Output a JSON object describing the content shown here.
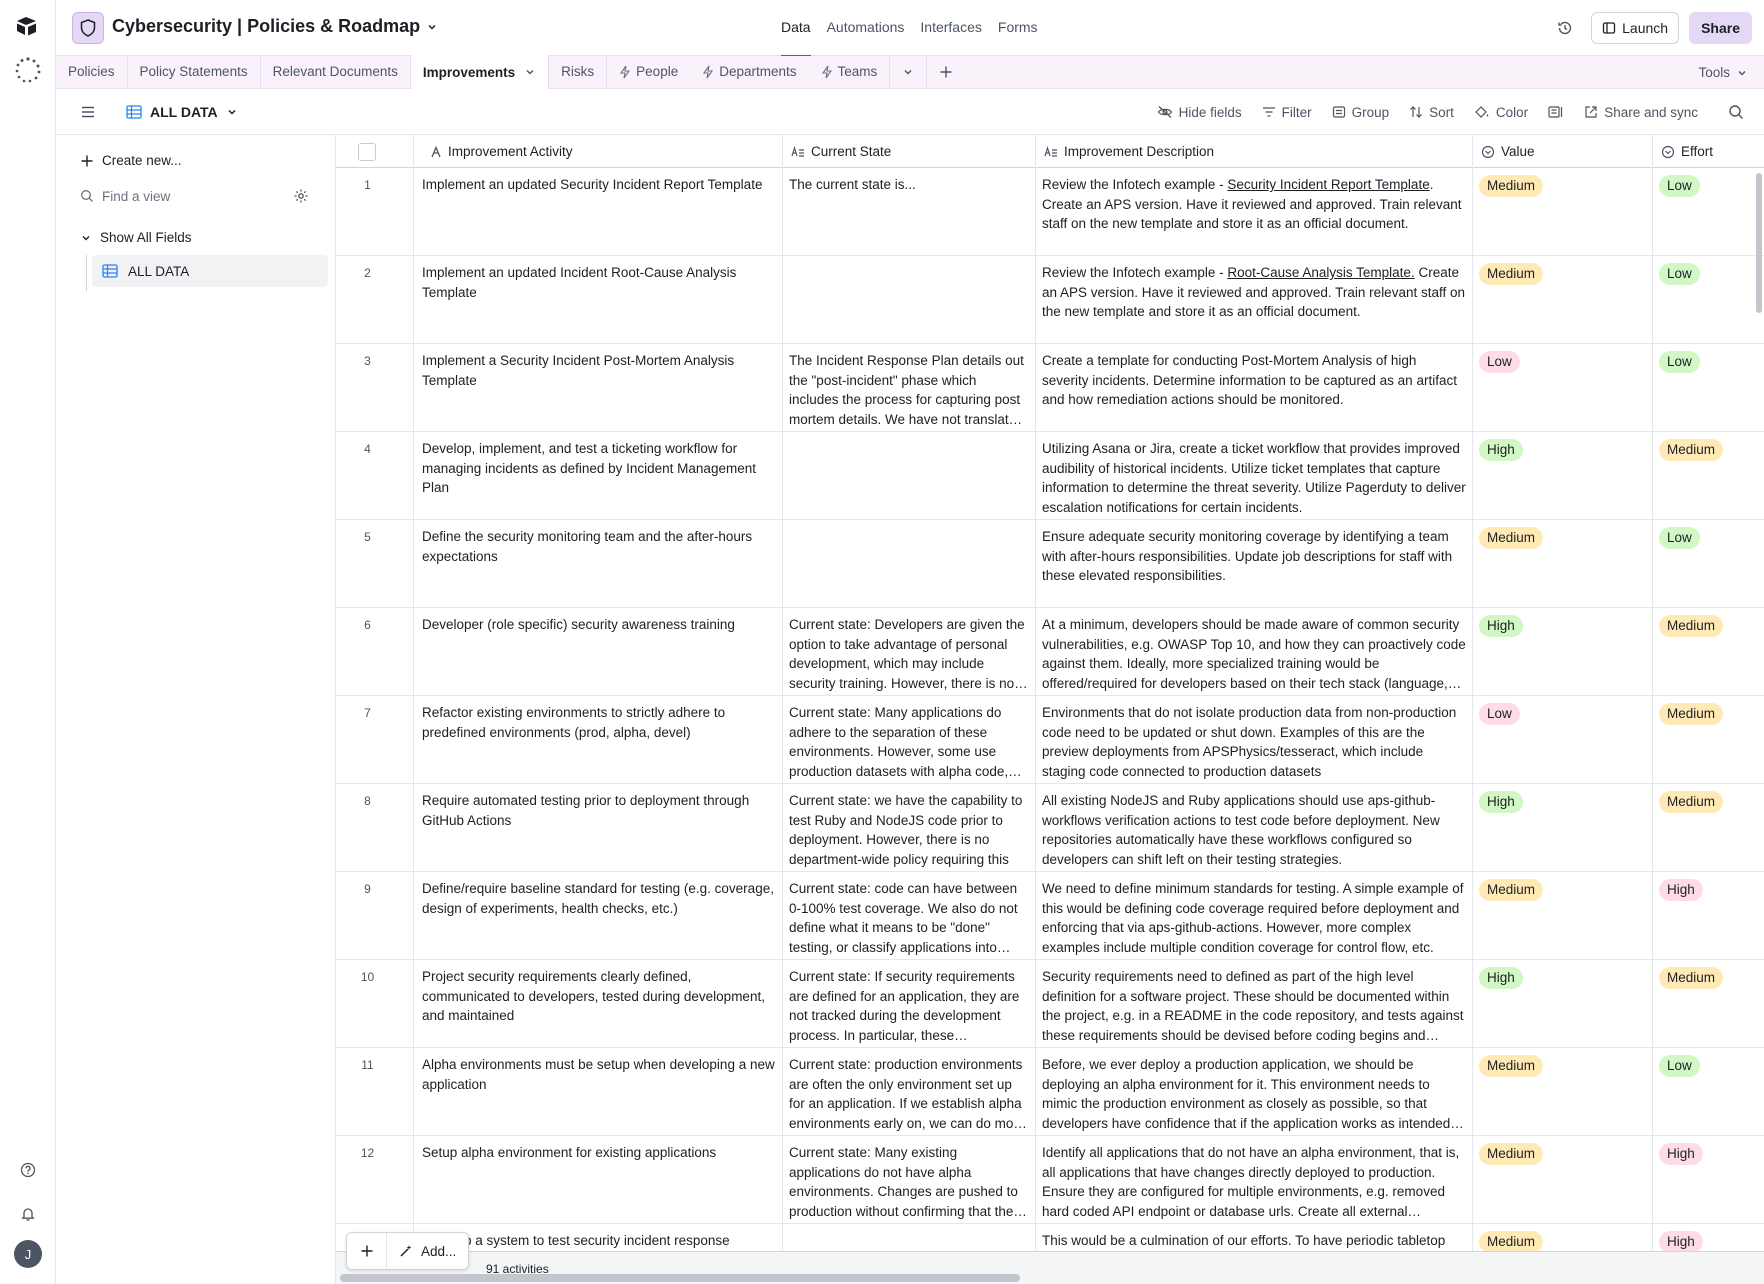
{
  "base": {
    "title": "Cybersecurity | Policies & Roadmap"
  },
  "top_nav": {
    "data": "Data",
    "automations": "Automations",
    "interfaces": "Interfaces",
    "forms": "Forms"
  },
  "top_right": {
    "launch": "Launch",
    "share": "Share"
  },
  "user": {
    "initial": "J"
  },
  "table_tabs": [
    "Policies",
    "Policy Statements",
    "Relevant Documents",
    "Improvements",
    "Risks",
    "People",
    "Departments",
    "Teams"
  ],
  "tools_label": "Tools",
  "view": {
    "name": "ALL DATA"
  },
  "viewbar": {
    "hide_fields": "Hide fields",
    "filter": "Filter",
    "group": "Group",
    "sort": "Sort",
    "color": "Color",
    "share_sync": "Share and sync"
  },
  "sidebar": {
    "create_new": "Create new...",
    "find_placeholder": "Find a view",
    "section": "Show All Fields",
    "view_item": "ALL DATA"
  },
  "columns": {
    "activity": "Improvement Activity",
    "current": "Current State",
    "description": "Improvement Description",
    "value": "Value",
    "effort": "Effort"
  },
  "rows": [
    {
      "num": "1",
      "activity": "Implement an updated Security Incident Report Template",
      "current": "The current state is...",
      "desc_pre": "Review the Infotech example - ",
      "desc_link": "Security Incident Report Template",
      "desc_post": ". Create an APS version. Have it reviewed and approved. Train relevant staff on the new template and store it as an official document.",
      "value": "Medium",
      "effort": "Low"
    },
    {
      "num": "2",
      "activity": "Implement an updated Incident Root-Cause Analysis Template",
      "current": "",
      "desc_pre": "Review the Infotech example - ",
      "desc_link": "Root-Cause Analysis Template.",
      "desc_post": " Create an APS version. Have it reviewed and approved. Train relevant staff on the new template and store it as an official document.",
      "value": "Medium",
      "effort": "Low"
    },
    {
      "num": "3",
      "activity": "Implement a Security Incident Post-Mortem Analysis Template",
      "current": "The Incident Response Plan details out the \"post-incident\" phase which includes the process for capturing post mortem details. We have not translated this into a template.",
      "desc_pre": "Create a template for conducting Post-Mortem Analysis of high severity incidents. Determine information to be captured as an artifact and how remediation actions should be monitored.",
      "desc_link": "",
      "desc_post": "",
      "value": "Low",
      "effort": "Low"
    },
    {
      "num": "4",
      "activity": "Develop, implement, and test a ticketing workflow for managing incidents as defined by Incident Management Plan",
      "current": "",
      "desc_pre": "Utilizing Asana or Jira, create a ticket workflow that provides improved audibility of historical incidents. Utilize ticket templates that capture information to determine the threat severity. Utilize Pagerduty to deliver escalation notifications for certain incidents.",
      "desc_link": "",
      "desc_post": "",
      "value": "High",
      "effort": "Medium"
    },
    {
      "num": "5",
      "activity": "Define the security monitoring team and the after-hours expectations",
      "current": "",
      "desc_pre": "Ensure adequate security monitoring coverage by identifying a team with after-hours responsibilities. Update job descriptions for staff with these elevated responsibilities.",
      "desc_link": "",
      "desc_post": "",
      "value": "Medium",
      "effort": "Low"
    },
    {
      "num": "6",
      "activity": "Developer (role specific) security awareness training",
      "current": "Current state: Developers are given the option to take advantage of personal development, which may include security training. However, there is no requirement.",
      "desc_pre": "At a minimum, developers should be made aware of common security vulnerabilities, e.g. OWASP Top 10, and how they can proactively code against them. Ideally, more specialized training would be offered/required for developers based on their tech stack (language, framework).",
      "desc_link": "",
      "desc_post": "",
      "value": "High",
      "effort": "Medium"
    },
    {
      "num": "7",
      "activity": "Refactor existing environments to strictly adhere to predefined environments (prod, alpha, devel)",
      "current": "Current state: Many applications do adhere to the separation of these environments. However, some use production datasets with alpha code, and vice versa.",
      "desc_pre": "Environments that do not isolate production data from non-production code need to be updated or shut down. Examples of this are the preview deployments from APSPhysics/tesseract, which include staging code connected to production datasets",
      "desc_link": "",
      "desc_post": "",
      "value": "Low",
      "effort": "Medium"
    },
    {
      "num": "8",
      "activity": "Require automated testing prior to deployment through GitHub Actions",
      "current": "Current state: we have the capability to test Ruby and NodeJS code prior to deployment. However, there is no department-wide policy requiring this",
      "desc_pre": "All existing NodeJS and Ruby applications should use aps-github-workflows verification actions to test code before deployment. New repositories automatically have these workflows configured so developers can shift left on their testing strategies.",
      "desc_link": "",
      "desc_post": "",
      "value": "High",
      "effort": "Medium"
    },
    {
      "num": "9",
      "activity": "Define/require baseline standard for testing (e.g. coverage, design of experiments, health checks, etc.)",
      "current": "Current state: code can have between 0-100% test coverage. We also do not define what it means to be \"done\" testing, or classify applications into tiers.",
      "desc_pre": "We need to define minimum standards for testing. A simple example of this would be defining code coverage required before deployment and enforcing that via aps-github-actions. However, more complex examples include multiple condition coverage for control flow, etc.",
      "desc_link": "",
      "desc_post": "",
      "value": "Medium",
      "effort": "High"
    },
    {
      "num": "10",
      "activity": "Project security requirements clearly defined, communicated to developers, tested during development, and maintained",
      "current": "Current state: If security requirements are defined for an application, they are not tracked during the development process. In particular, these requirements are lost.",
      "desc_pre": "Security requirements need to defined as part of the high level definition for a software project. These should be documented within the project, e.g. in a README in the code repository, and tests against these requirements should be devised before coding begins and maintained.",
      "desc_link": "",
      "desc_post": "",
      "value": "High",
      "effort": "Medium"
    },
    {
      "num": "11",
      "activity": "Alpha environments must be setup when developing a new application",
      "current": "Current state: production environments are often the only environment set up for an application. If we establish alpha environments early on, we can do more testing.",
      "desc_pre": "Before, we ever deploy a production application, we should be deploying an alpha environment for it. This environment needs to mimic the production environment as closely as possible, so that developers have confidence that if the application works as intended in alpha.",
      "desc_link": "",
      "desc_post": "",
      "value": "Medium",
      "effort": "Low"
    },
    {
      "num": "12",
      "activity": "Setup alpha environment for existing applications",
      "current": "Current state: Many existing applications do not have alpha environments. Changes are pushed to production without confirming that they work.",
      "desc_pre": "Identify all applications that do not have an alpha environment, that is, all applications that have changes directly deployed to production. Ensure they are configured for multiple environments, e.g. removed hard coded API endpoint or database urls. Create all external resources.",
      "desc_link": "",
      "desc_post": "",
      "value": "Medium",
      "effort": "High"
    },
    {
      "num": "13",
      "activity": "Develop a system to test security incident response",
      "current": "",
      "desc_pre": "This would be a culmination of our efforts. To have periodic tabletop",
      "desc_link": "",
      "desc_post": "",
      "value": "Medium",
      "effort": "High"
    }
  ],
  "footer": {
    "add_label": "Add...",
    "count": "91 activities"
  },
  "colors": {
    "accent": "#7c3aed",
    "tab_bg": "#faf2fb",
    "medium": "#ffeab6",
    "low_green": "#d1f7c4",
    "pink": "#ffdce5"
  }
}
